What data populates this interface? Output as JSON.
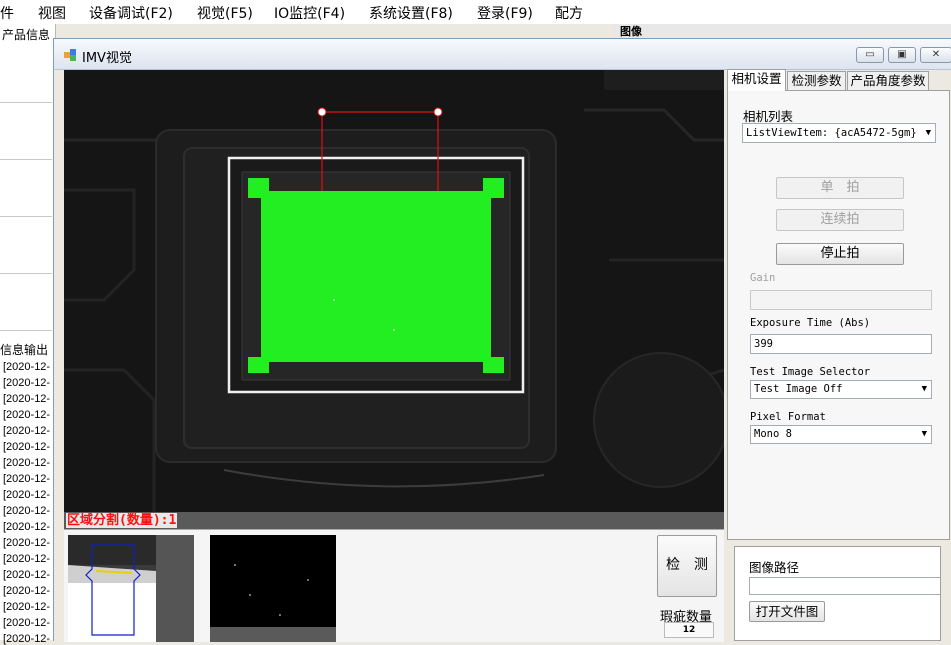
{
  "menu": [
    "件",
    "视图",
    "设备调试(F2)",
    "视觉(F5)",
    "IO监控(F4)",
    "系统设置(F8)",
    "登录(F9)",
    "配方"
  ],
  "background": {
    "product_info_title": "产品信息",
    "info_output_title": "信息输出",
    "right_title": "图像",
    "log_lines": [
      "[2020-12-",
      "[2020-12-",
      "[2020-12-",
      "[2020-12-",
      "[2020-12-",
      "[2020-12-",
      "[2020-12-",
      "[2020-12-",
      "[2020-12-",
      "[2020-12-",
      "[2020-12-",
      "[2020-12-",
      "[2020-12-",
      "[2020-12-",
      "[2020-12-",
      "[2020-12-",
      "[2020-12-",
      "[2020-12-"
    ]
  },
  "window": {
    "title": "IMV视觉",
    "minimize_glyph": "▭",
    "restore_glyph": "▣",
    "close_glyph": "✕"
  },
  "image_view": {
    "region_label": "区域分割(数量):1",
    "detect_button": "检　测",
    "defect_count_label": "瑕疵数量",
    "defect_count_value": "12"
  },
  "tabs": [
    {
      "label": "相机设置",
      "active": true
    },
    {
      "label": "检测参数",
      "active": false
    },
    {
      "label": "产品角度参数",
      "active": false
    }
  ],
  "camera_settings": {
    "camera_list_label": "相机列表",
    "camera_list_value": "ListViewItem: {acA5472-5gm}",
    "single_shot_button": "单　拍",
    "continuous_button": "连续拍",
    "stop_button": "停止拍",
    "gain_label": "Gain",
    "gain_value": "",
    "exposure_label": "Exposure Time (Abs)",
    "exposure_value": "399",
    "test_image_label": "Test Image Selector",
    "test_image_value": "Test Image Off",
    "pixel_format_label": "Pixel Format",
    "pixel_format_value": "Mono 8"
  },
  "image_path": {
    "title": "图像路径",
    "value": "",
    "open_button": "打开文件图"
  },
  "colors": {
    "region_fill": "#22ee22",
    "roi_line": "#dd1111",
    "label_red": "#ff1010"
  }
}
